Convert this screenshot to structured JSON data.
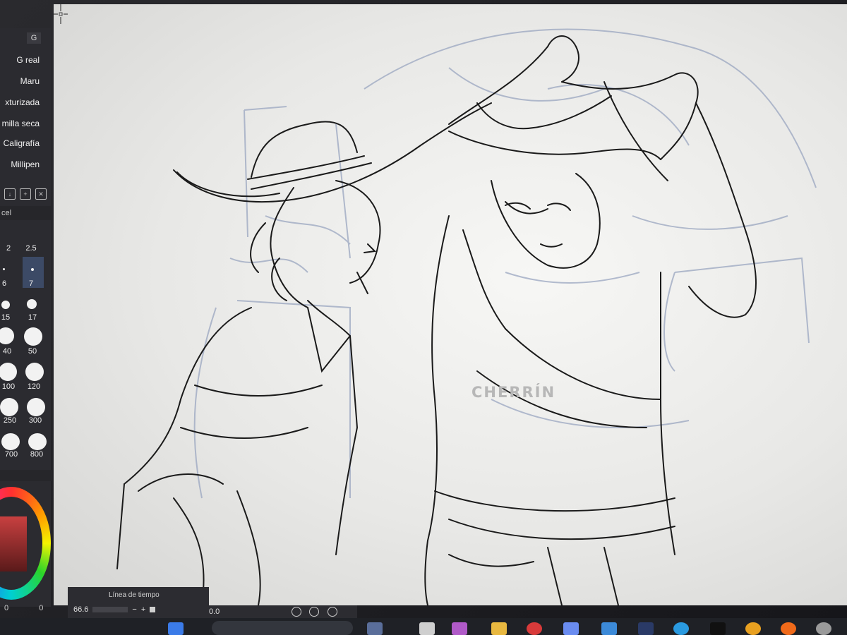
{
  "brush_panel": {
    "tab": "G",
    "brushes": [
      "G real",
      "Maru",
      "xturizada",
      "milla seca",
      "Caligrafía",
      "Millipen"
    ],
    "section_label": "cel",
    "sizes": [
      "2",
      "2.5",
      "6",
      "7",
      "15",
      "17",
      "40",
      "50",
      "100",
      "120",
      "250",
      "300",
      "700",
      "800"
    ],
    "selected_size": "7"
  },
  "canvas": {
    "watermark": "CHERRÍN"
  },
  "timeline": {
    "title": "Línea de tiempo",
    "zoom_value": "66.6",
    "minus_label": "−",
    "plus_label": "+",
    "angle_value": "0.0"
  },
  "bottom_left": {
    "left_value": "0",
    "right_value": "0"
  },
  "taskbar": {
    "icons": [
      "windows-start-icon",
      "search-icon",
      "file-explorer-icon",
      "pinterest-icon",
      "copilot-icon",
      "store-icon",
      "clip-studio-icon",
      "edge-icon",
      "tiktok-icon",
      "chrome-icon",
      "firefox-icon",
      "app-icon"
    ]
  },
  "colors": {
    "panel_bg": "#2b2b30",
    "canvas_bg": "#f3f3f1",
    "sketch_line": "#1a1a1a",
    "rough_line": "#9aa6c0",
    "watermark": "#b7b7b7"
  }
}
